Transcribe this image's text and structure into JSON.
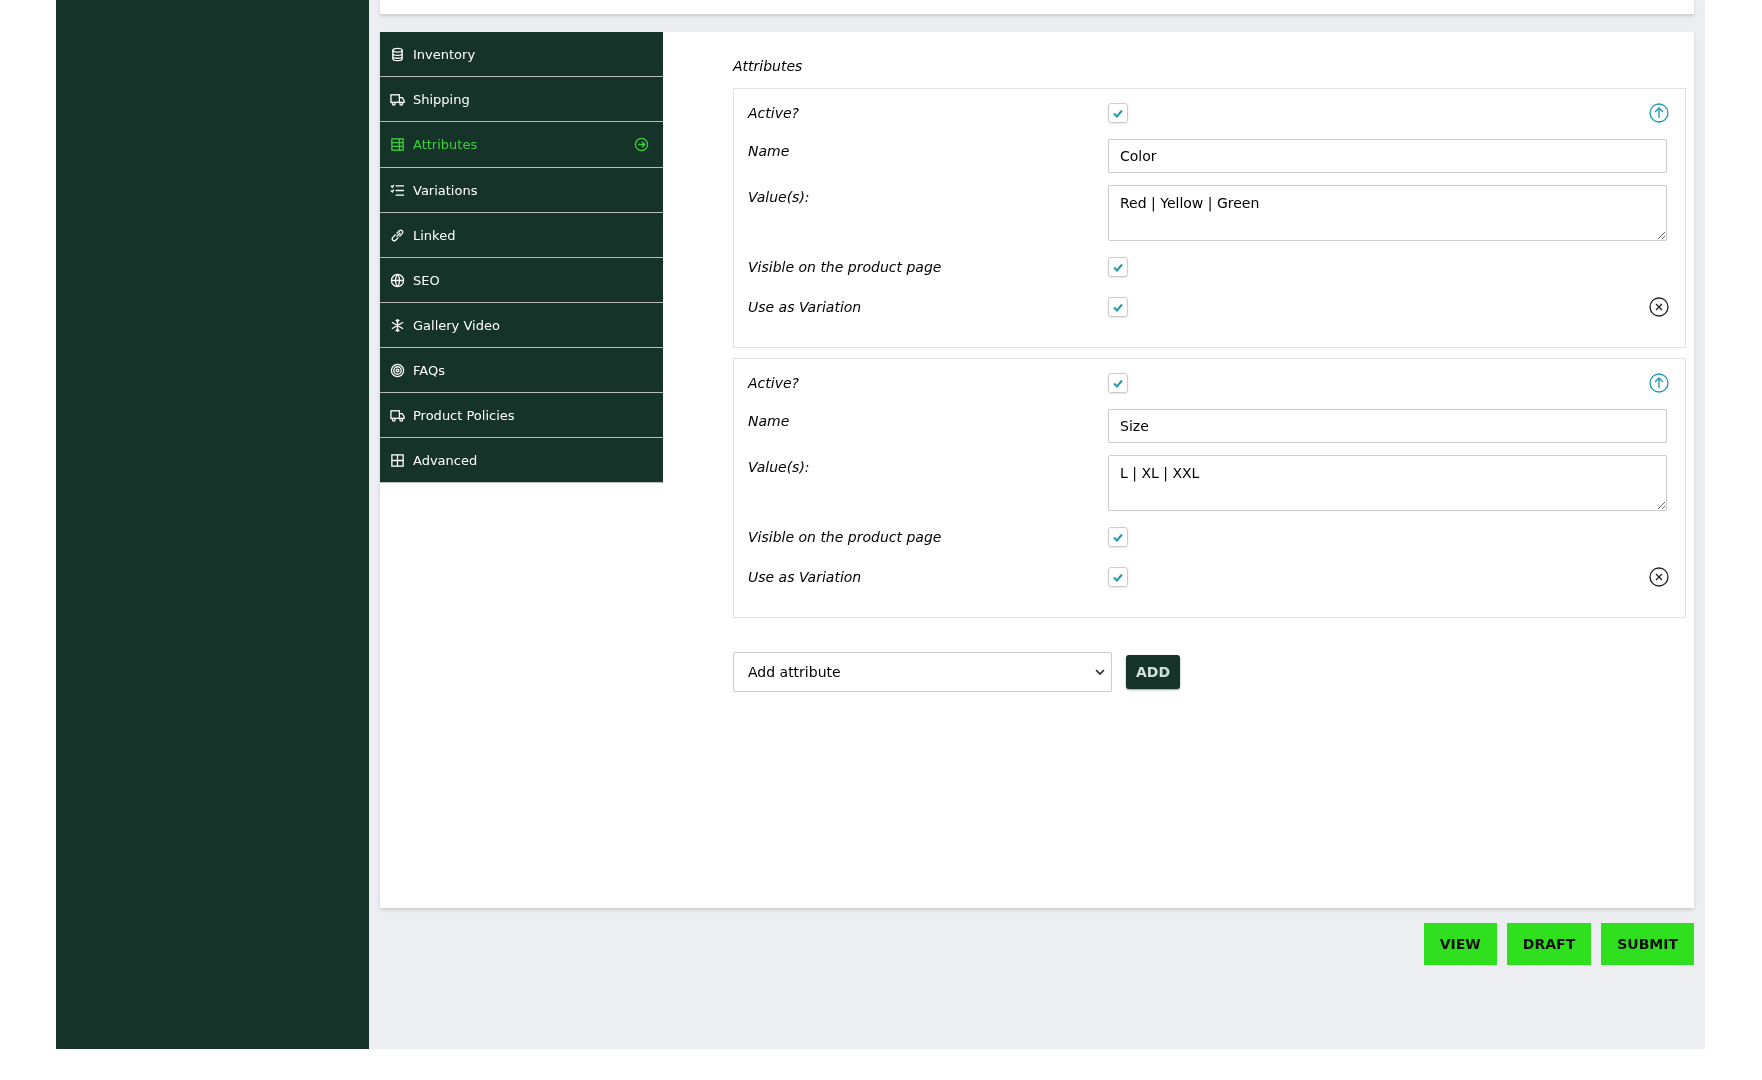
{
  "tabs": [
    {
      "label": "Inventory",
      "selected": false
    },
    {
      "label": "Shipping",
      "selected": false
    },
    {
      "label": "Attributes",
      "selected": true
    },
    {
      "label": "Variations",
      "selected": false
    },
    {
      "label": "Linked",
      "selected": false
    },
    {
      "label": "SEO",
      "selected": false
    },
    {
      "label": "Gallery Video",
      "selected": false
    },
    {
      "label": "FAQs",
      "selected": false
    },
    {
      "label": "Product Policies",
      "selected": false
    },
    {
      "label": "Advanced",
      "selected": false
    }
  ],
  "section_title": "Attributes",
  "attributes": [
    {
      "active_label": "Active?",
      "active": true,
      "name_label": "Name",
      "name": "Color",
      "values_label": "Value(s):",
      "values": "Red | Yellow | Green",
      "visible_label": "Visible on the product page",
      "visible": true,
      "variation_label": "Use as Variation",
      "variation": true
    },
    {
      "active_label": "Active?",
      "active": true,
      "name_label": "Name",
      "name": "Size",
      "values_label": "Value(s):",
      "values": "L | XL | XXL",
      "visible_label": "Visible on the product page",
      "visible": true,
      "variation_label": "Use as Variation",
      "variation": true
    }
  ],
  "add_select": {
    "value": "Add attribute"
  },
  "add_button": "ADD",
  "actions": [
    "VIEW",
    "DRAFT",
    "SUBMIT"
  ]
}
